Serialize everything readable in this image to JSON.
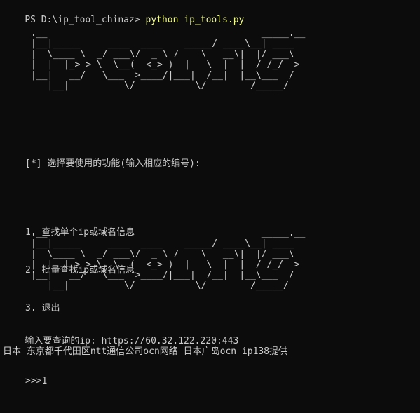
{
  "prompt": {
    "path": "PS D:\\ip_tool_chinaz> ",
    "command": "python ip_tools.py"
  },
  "banner_art": ".__                                       _____.__\n|__|_____     ____  ____    _____/ ____\\__| ____\n|  \\____ \\  _/ ___\\/  _ \\ /    \\   __\\|  |/ ___\\\n|  |  |_> > \\  \\__(  <_> )  |   \\  |  |  / /_/  >\n|__|   __/   \\___  >____/|___|  /__|  |__\\___  /\n   |__|          \\/           \\/        /_____/",
  "menu": {
    "title": "[*] 选择要使用的功能(输入相应的编号):",
    "options": [
      "1. 查找单个ip或域名信息",
      "2. 批量查找ip或域名信息",
      "3. 退出"
    ],
    "input_prompt": ">>>1"
  },
  "query": {
    "prompt_label": "输入要查询的ip: ",
    "value": "https://60.32.122.220:443"
  },
  "result": "日本 东京都千代田区ntt通信公司ocn网络 日本广岛ocn ip138提供",
  "colors": {
    "background": "#0c0c0c",
    "text": "#cccccc",
    "command": "#f1fa8c"
  }
}
